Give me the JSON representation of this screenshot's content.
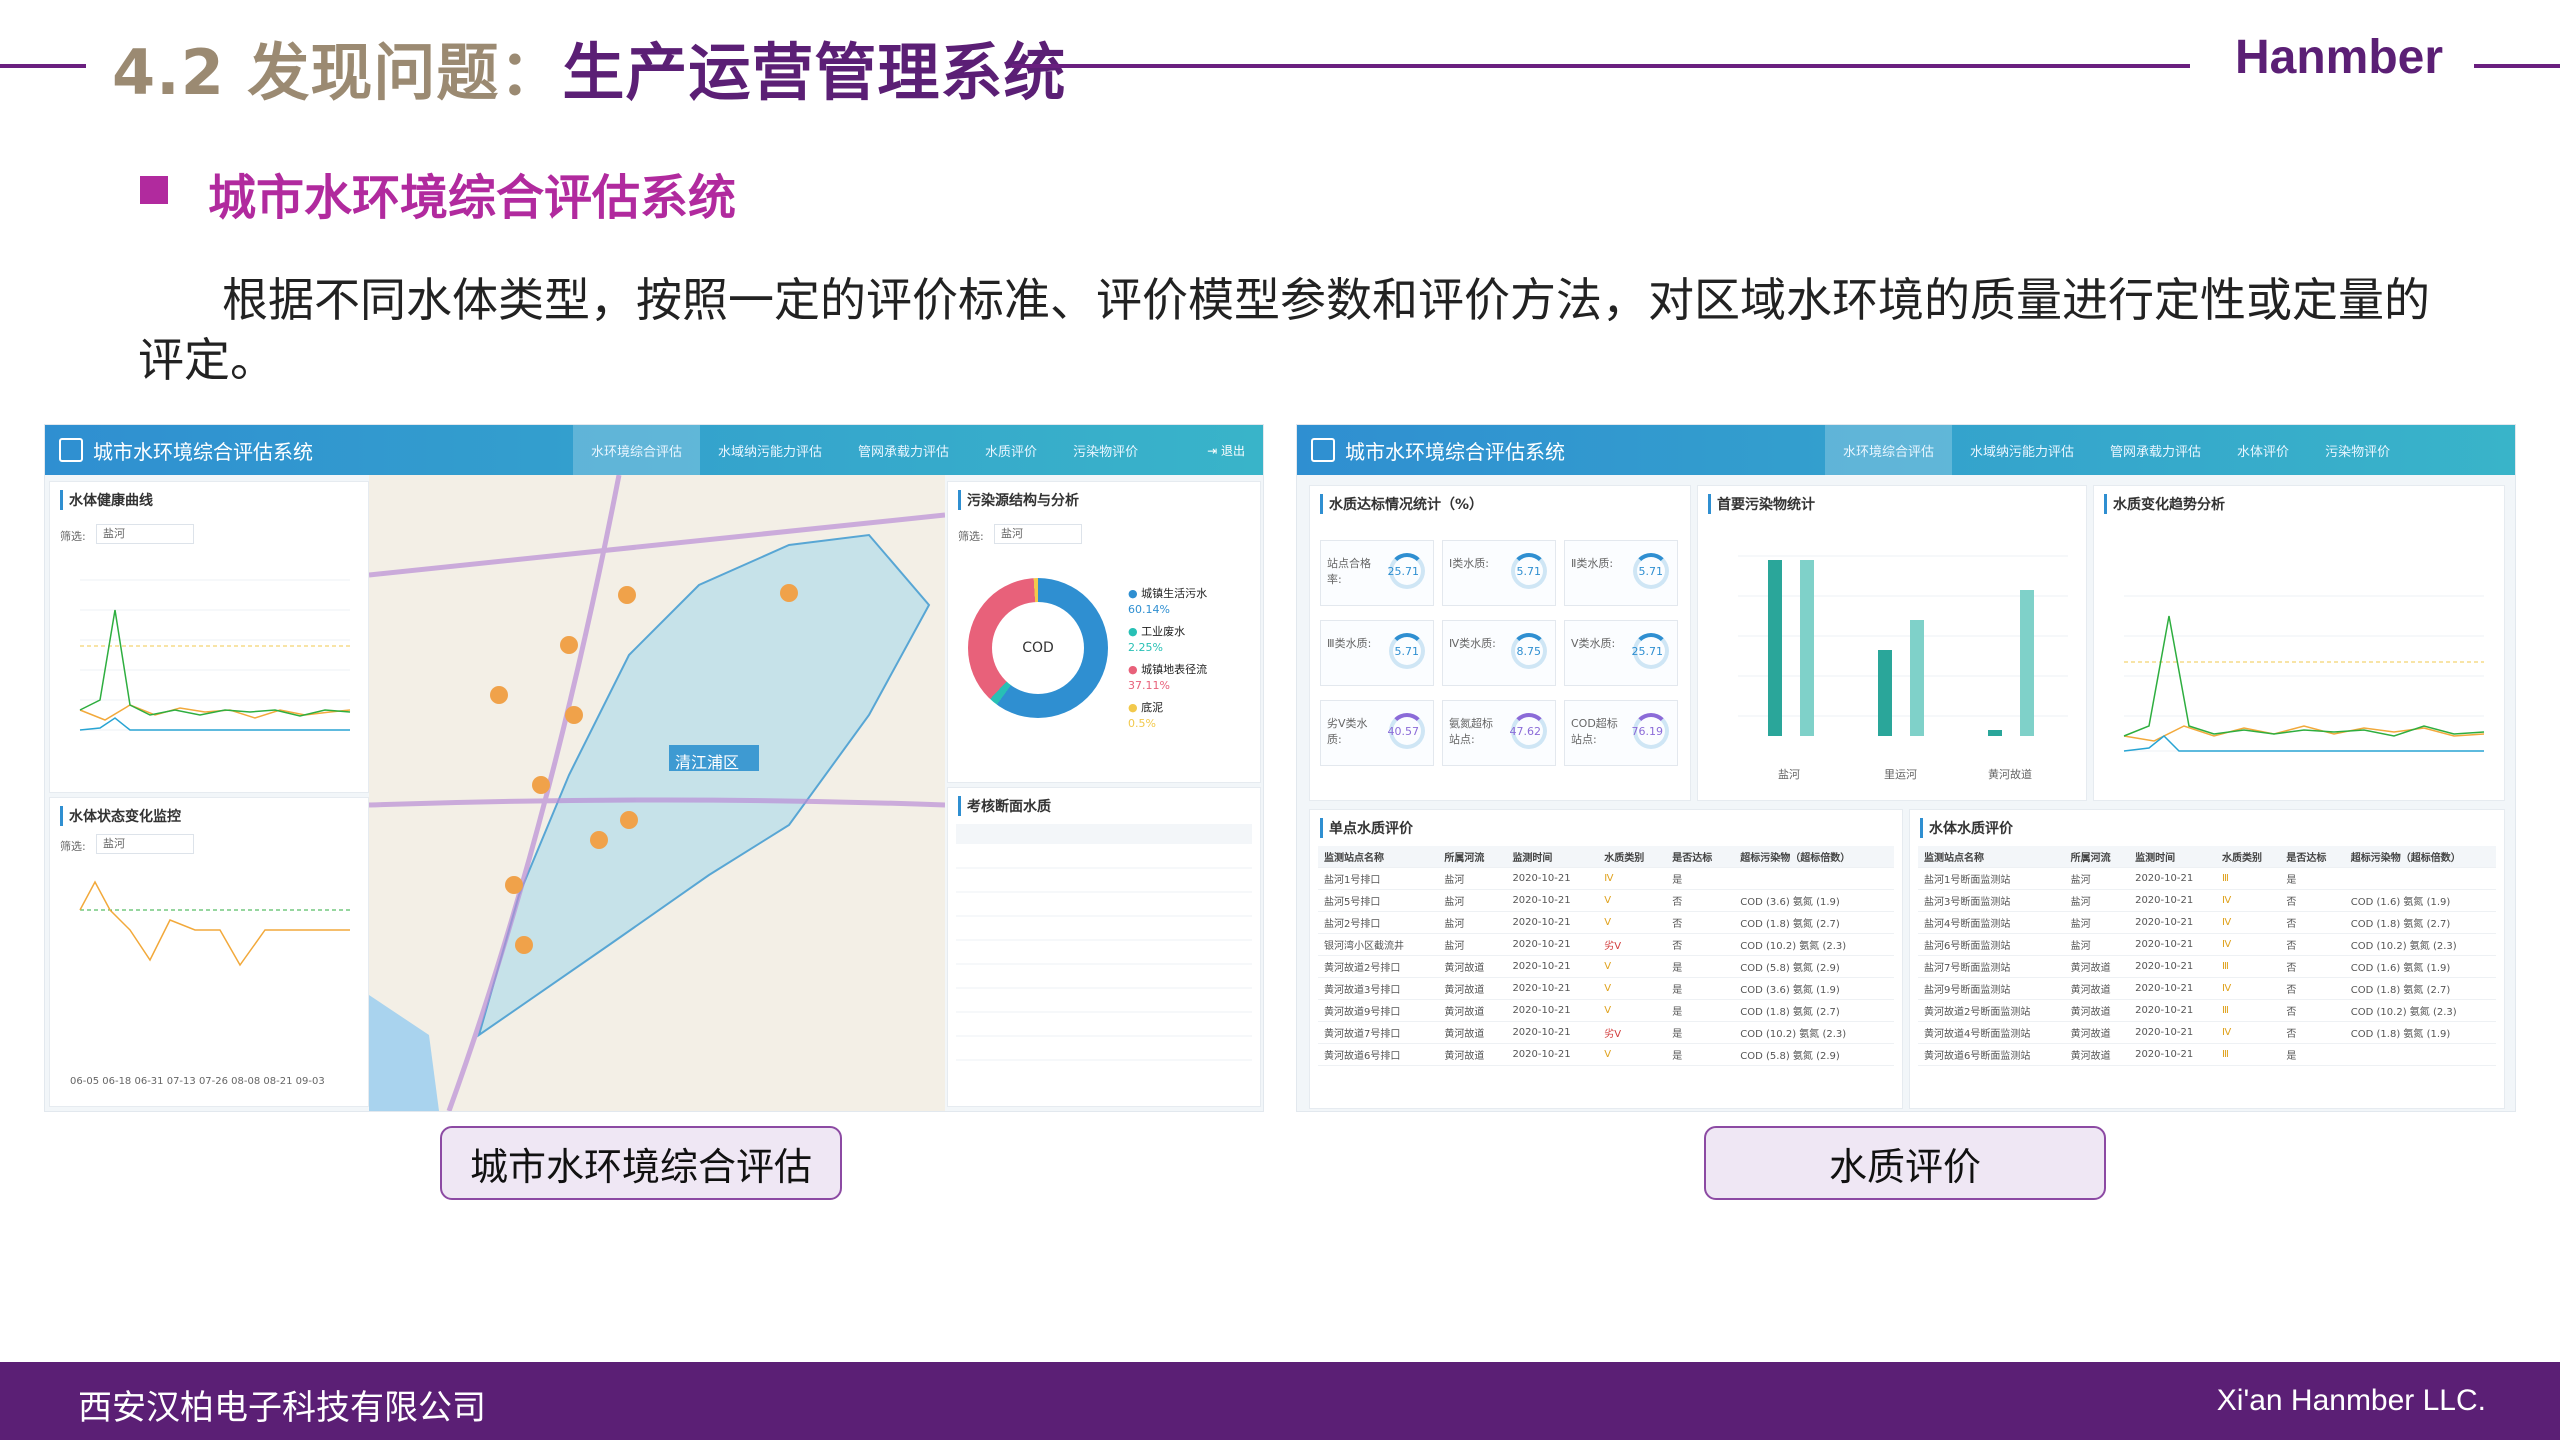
{
  "header": {
    "title_number": "4.2 发现问题：",
    "title_text": "生产运营管理系统",
    "brand": "Hanmber"
  },
  "section": {
    "bullet_title": "城市水环境综合评估系统",
    "paragraph": "根据不同水体类型，按照一定的评价标准、评价模型参数和评价方法，对区域水环境的质量进行定性或定量的评定。"
  },
  "screenshot_left": {
    "app_title": "城市水环境综合评估系统",
    "nav": [
      "水环境综合评估",
      "水域纳污能力评估",
      "管网承载力评估",
      "水质评价",
      "污染物评价"
    ],
    "logout": "退出",
    "panel_health": "水体健康曲线",
    "panel_state": "水体状态变化监控",
    "panel_source": "污染源结构与分析",
    "panel_section": "考核断面水质",
    "filter_label": "筛选:",
    "filter_value": "盐河",
    "district": "清江浦区",
    "donut_center": "COD",
    "legend": [
      {
        "label": "城镇生活污水",
        "value": "60.14%"
      },
      {
        "label": "工业废水",
        "value": "2.25%"
      },
      {
        "label": "城镇地表径流",
        "value": "37.11%"
      },
      {
        "label": "底泥",
        "value": "0.5%"
      }
    ],
    "dates": "06-05 06-18 06-31 07-13 07-26 08-08 08-21 09-03"
  },
  "screenshot_right": {
    "app_title": "城市水环境综合评估系统",
    "nav": [
      "水环境综合评估",
      "水域纳污能力评估",
      "管网承载力评估",
      "水体评价",
      "污染物评价"
    ],
    "panel_rate": "水质达标情况统计（%）",
    "panel_pollutant": "首要污染物统计",
    "panel_trend": "水质变化趋势分析",
    "panel_single": "单点水质评价",
    "panel_body": "水体水质评价",
    "kpis": [
      {
        "label": "站点合格率:",
        "value": "25.71"
      },
      {
        "label": "Ⅰ类水质:",
        "value": "5.71"
      },
      {
        "label": "Ⅱ类水质:",
        "value": "5.71"
      },
      {
        "label": "Ⅲ类水质:",
        "value": "5.71"
      },
      {
        "label": "Ⅳ类水质:",
        "value": "8.75"
      },
      {
        "label": "Ⅴ类水质:",
        "value": "25.71"
      },
      {
        "label": "劣Ⅴ类水质:",
        "value": "40.57"
      },
      {
        "label": "氨氮超标站点:",
        "value": "47.62"
      },
      {
        "label": "COD超标站点:",
        "value": "76.19"
      }
    ],
    "bars": {
      "categories": [
        "盐河",
        "里运河",
        "黄河故道"
      ]
    },
    "single_headers": [
      "监测站点名称",
      "所属河流",
      "监测时间",
      "水质类别",
      "是否达标",
      "超标污染物（超标倍数）"
    ],
    "single_rows": [
      [
        "盐河1号排口",
        "盐河",
        "2020-10-21",
        "Ⅳ",
        "是",
        ""
      ],
      [
        "盐河5号排口",
        "盐河",
        "2020-10-21",
        "Ⅴ",
        "否",
        "COD (3.6)   氨氮 (1.9)"
      ],
      [
        "盐河2号排口",
        "盐河",
        "2020-10-21",
        "Ⅴ",
        "否",
        "COD (1.8)   氨氮 (2.7)"
      ],
      [
        "银河湾小区截流井",
        "盐河",
        "2020-10-21",
        "劣Ⅴ",
        "否",
        "COD (10.2)   氨氮 (2.3)"
      ],
      [
        "黄河故道2号排口",
        "黄河故道",
        "2020-10-21",
        "Ⅴ",
        "是",
        "COD (5.8)   氨氮 (2.9)"
      ],
      [
        "黄河故道3号排口",
        "黄河故道",
        "2020-10-21",
        "Ⅴ",
        "是",
        "COD (3.6)   氨氮 (1.9)"
      ],
      [
        "黄河故道9号排口",
        "黄河故道",
        "2020-10-21",
        "Ⅴ",
        "是",
        "COD (1.8)   氨氮 (2.7)"
      ],
      [
        "黄河故道7号排口",
        "黄河故道",
        "2020-10-21",
        "劣Ⅴ",
        "是",
        "COD (10.2)   氨氮 (2.3)"
      ],
      [
        "黄河故道6号排口",
        "黄河故道",
        "2020-10-21",
        "Ⅴ",
        "是",
        "COD (5.8)   氨氮 (2.9)"
      ]
    ],
    "body_headers": [
      "监测站点名称",
      "所属河流",
      "监测时间",
      "水质类别",
      "是否达标",
      "超标污染物（超标倍数）"
    ],
    "body_rows": [
      [
        "盐河1号断面监测站",
        "盐河",
        "2020-10-21",
        "Ⅲ",
        "是",
        ""
      ],
      [
        "盐河3号断面监测站",
        "盐河",
        "2020-10-21",
        "Ⅳ",
        "否",
        "COD (1.6)   氨氮 (1.9)"
      ],
      [
        "盐河4号断面监测站",
        "盐河",
        "2020-10-21",
        "Ⅳ",
        "否",
        "COD (1.8)   氨氮 (2.7)"
      ],
      [
        "盐河6号断面监测站",
        "盐河",
        "2020-10-21",
        "Ⅳ",
        "否",
        "COD (10.2)   氨氮 (2.3)"
      ],
      [
        "盐河7号断面监测站",
        "黄河故道",
        "2020-10-21",
        "Ⅲ",
        "否",
        "COD (1.6)   氨氮 (1.9)"
      ],
      [
        "盐河9号断面监测站",
        "黄河故道",
        "2020-10-21",
        "Ⅳ",
        "否",
        "COD (1.8)   氨氮 (2.7)"
      ],
      [
        "黄河故道2号断面监测站",
        "黄河故道",
        "2020-10-21",
        "Ⅲ",
        "否",
        "COD (10.2)   氨氮 (2.3)"
      ],
      [
        "黄河故道4号断面监测站",
        "黄河故道",
        "2020-10-21",
        "Ⅳ",
        "否",
        "COD (1.8)   氨氮 (1.9)"
      ],
      [
        "黄河故道6号断面监测站",
        "黄河故道",
        "2020-10-21",
        "Ⅲ",
        "是",
        ""
      ]
    ]
  },
  "captions": {
    "left": "城市水环境综合评估",
    "right": "水质评价"
  },
  "footer": {
    "company_cn": "西安汉柏电子科技有限公司",
    "company_en": "Xi'an Hanmber LLC."
  }
}
